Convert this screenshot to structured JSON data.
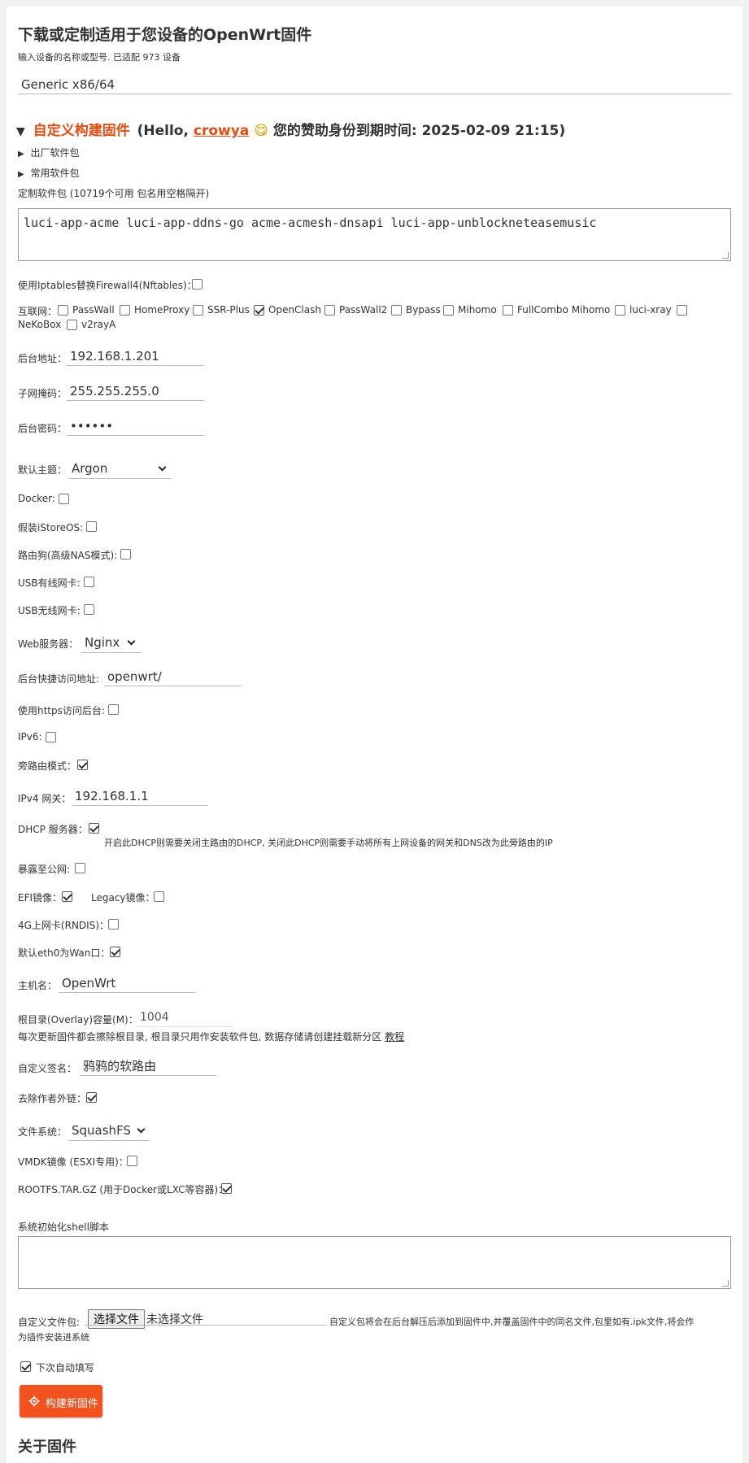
{
  "header": {
    "title": "下载或定制适用于您设备的OpenWrt固件",
    "subtitle": "输入设备的名称或型号. 已适配 973 设备",
    "device_value": "Generic x86/64"
  },
  "custom_build": {
    "title": "自定义构建固件",
    "hello_prefix": "(Hello, ",
    "username": "crowya",
    "emoji": "😋",
    "sponsor_text": "您的赞助身份到期时间: 2025-02-09 21:15)",
    "factory_packages_label": "出厂软件包",
    "common_packages_label": "常用软件包",
    "custom_packages_label": "定制软件包 (10719个可用 包名用空格隔开)",
    "packages_value": "luci-app-acme luci-app-ddns-go acme-acmesh-dnsapi luci-app-unblockneteasemusic"
  },
  "options": {
    "iptables_label": "使用Iptables替换Firewall4(Nftables)：",
    "internet_label": "互联网：",
    "internet_items": [
      {
        "label": "PassWall",
        "checked": false
      },
      {
        "label": "HomeProxy",
        "checked": false
      },
      {
        "label": "SSR-Plus",
        "checked": false
      },
      {
        "label": "OpenClash",
        "checked": true
      },
      {
        "label": "PassWall2",
        "checked": false
      },
      {
        "label": "Bypass",
        "checked": false
      },
      {
        "label": "Mihomo",
        "checked": false
      },
      {
        "label": "FullCombo Mihomo",
        "checked": false
      },
      {
        "label": "luci-xray",
        "checked": false
      },
      {
        "label": "NeKoBox",
        "checked": false
      },
      {
        "label": "v2rayA",
        "checked": false
      }
    ],
    "admin_addr_label": "后台地址：",
    "admin_addr_value": "192.168.1.201",
    "netmask_label": "子网掩码：",
    "netmask_value": "255.255.255.0",
    "password_label": "后台密码：",
    "password_value": "••••••",
    "theme_label": "默认主题：",
    "theme_value": "Argon",
    "docker_label": "Docker:",
    "istoreos_label": "假装iStoreOS:",
    "nas_label": "路由狗(高级NAS模式):",
    "usb_wired_label": "USB有线网卡:",
    "usb_wireless_label": "USB无线网卡:",
    "web_server_label": "Web服务器：",
    "web_server_value": "Nginx",
    "shortcut_label": "后台快捷访问地址:",
    "shortcut_value": "openwrt/",
    "https_label": "使用https访问后台:",
    "ipv6_label": "IPv6:",
    "bypass_mode_label": "旁路由模式：",
    "gateway_label": "IPv4 网关：",
    "gateway_value": "192.168.1.1",
    "dhcp_label": "DHCP 服务器：",
    "dhcp_note": "开启此DHCP则需要关闭主路由的DHCP, 关闭此DHCP则需要手动将所有上网设备的网关和DNS改为此旁路由的IP",
    "public_label": "暴露至公网:",
    "efi_label": "EFI镜像：",
    "legacy_label": "Legacy镜像：",
    "rndis_label": "4G上网卡(RNDIS)：",
    "eth0_label": "默认eth0为Wan口：",
    "hostname_label": "主机名：",
    "hostname_value": "OpenWrt",
    "overlay_label": "根目录(Overlay)容量(M)：",
    "overlay_value": "1004",
    "overlay_note": "每次更新固件都会擦除根目录, 根目录只用作安装软件包, 数据存储请创建挂载新分区 ",
    "overlay_link": "教程",
    "signature_label": "自定义签名：",
    "signature_value": "鸦鸦的软路由",
    "remove_author_label": "去除作者外链：",
    "fs_label": "文件系统：",
    "fs_value": "SquashFS",
    "vmdk_label": "VMDK镜像 (ESXI专用)：",
    "rootfs_label": "ROOTFS.TAR.GZ (用于Docker或LXC等容器)：",
    "shell_label": "系统初始化shell脚本",
    "file_label": "自定义文件包:",
    "file_button": "选择文件",
    "file_none": "未选择文件",
    "file_note_1": "自定义包将会在后台解压后添加到固件中,并覆盖固件中的同名文件,包里如有.ipk文件,将会作",
    "file_note_2": "为插件安装进系统",
    "autofill_label": "下次自动填写",
    "build_button": "构建新固件"
  },
  "footer": {
    "about_title": "关于固件"
  },
  "colors": {
    "accent": "#f2531e",
    "accent_text": "#e74c11"
  }
}
